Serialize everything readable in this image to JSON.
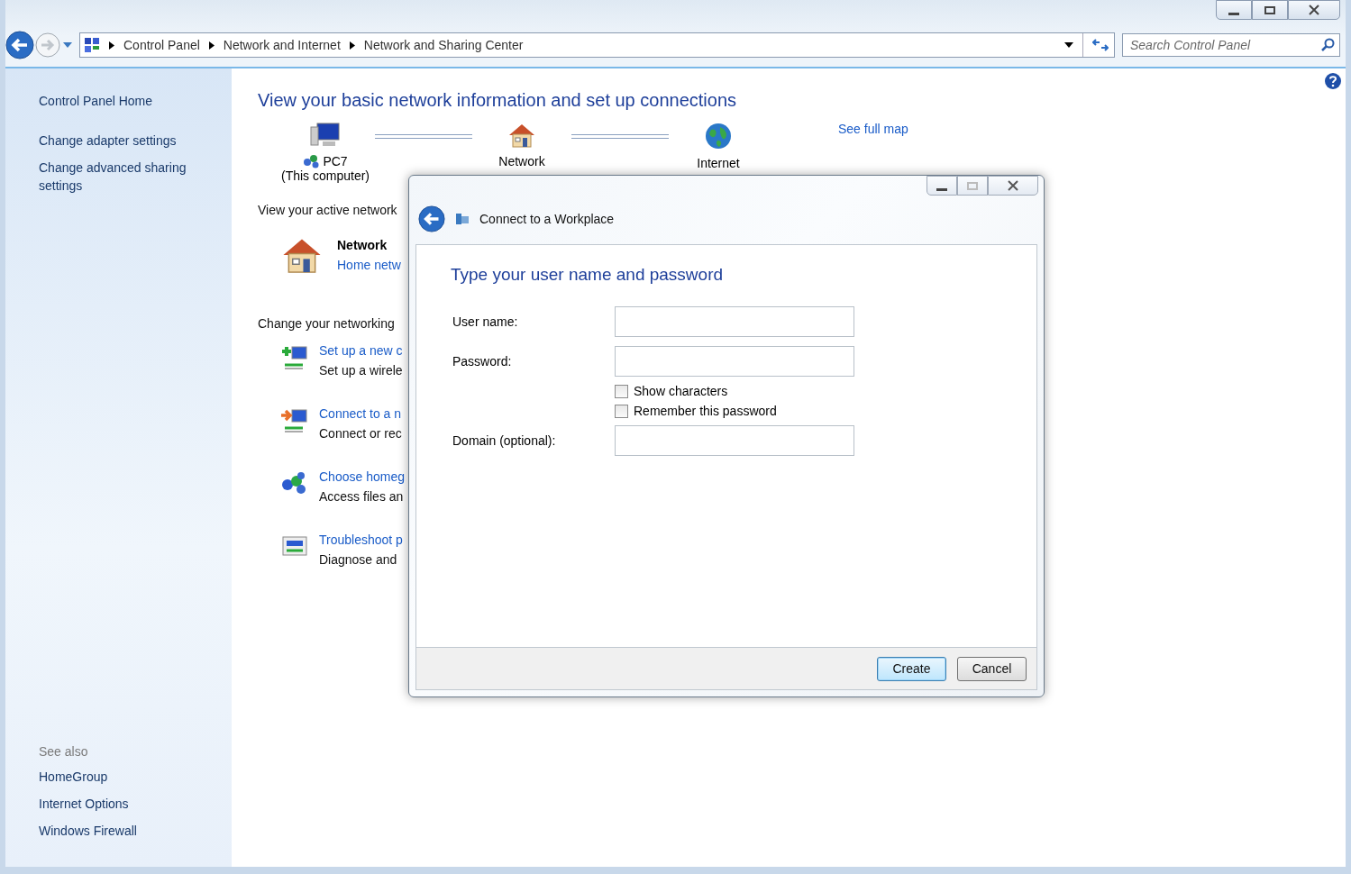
{
  "breadcrumb": [
    "Control Panel",
    "Network and Internet",
    "Network and Sharing Center"
  ],
  "search": {
    "placeholder": "Search Control Panel"
  },
  "sidebar": {
    "items": [
      "Control Panel Home",
      "Change adapter settings",
      "Change advanced sharing settings"
    ],
    "see_also_title": "See also",
    "see_also": [
      "HomeGroup",
      "Internet Options",
      "Windows Firewall"
    ]
  },
  "main": {
    "heading": "View your basic network information and set up connections",
    "map": [
      {
        "kind": "computer",
        "label": "PC7",
        "sublabel": "(This computer)"
      },
      {
        "kind": "house",
        "label": "Network"
      },
      {
        "kind": "globe",
        "label": "Internet"
      }
    ],
    "see_full_map": "See full map",
    "active_title": "View your active network",
    "network": {
      "name": "Network",
      "type": "Home netw"
    },
    "change_title": "Change your networking",
    "tasks": [
      {
        "kind": "add",
        "link": "Set up a new c",
        "text": "Set up a wirele"
      },
      {
        "kind": "connect",
        "link": "Connect to a n",
        "text": "Connect or rec"
      },
      {
        "kind": "homegroup",
        "link": "Choose homeg",
        "text": "Access files an"
      },
      {
        "kind": "troubleshoot",
        "link": "Troubleshoot p",
        "text": "Diagnose and"
      }
    ]
  },
  "dialog": {
    "title": "Connect to a Workplace",
    "heading": "Type your user name and password",
    "fields": [
      {
        "kind": "text",
        "label": "User name:"
      },
      {
        "kind": "text",
        "label": "Password:"
      },
      {
        "kind": "check",
        "label": "Show characters",
        "checked": false
      },
      {
        "kind": "check",
        "label": "Remember this password",
        "checked": false
      },
      {
        "kind": "text",
        "label": "Domain (optional):"
      }
    ],
    "buttons": [
      {
        "label": "Create",
        "default": true
      },
      {
        "label": "Cancel",
        "default": false
      }
    ]
  }
}
